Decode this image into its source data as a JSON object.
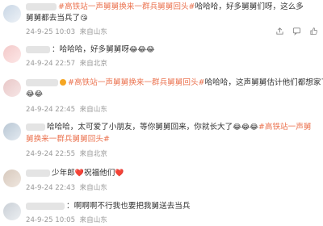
{
  "comments": [
    {
      "line1": "#高铁站一声舅舅换来一群兵舅舅回头#哈哈哈，好多舅舅们呀，这么多",
      "line2": "舅舅都去当兵了",
      "topic": "#高铁站一声舅舅换来一群兵舅舅回头#",
      "text_after_topic": "哈哈哈，好多舅舅们呀，这么多",
      "emoji": "😘",
      "time": "24-9-25 10:03",
      "location": "来自山东"
    },
    {
      "line1": "：哈哈哈，好多舅舅呀",
      "emoji": "😂😂😂",
      "time": "24-9-24 22:57",
      "location": "来自北京"
    },
    {
      "topic": "#高铁站一声舅舅换来一群兵舅舅回头#",
      "text_after_topic": "哈哈哈，这声舅舅估计他们都想家了",
      "emoji": "😂😂",
      "time": "24-9-24 22:45",
      "location": "来自山东"
    },
    {
      "line1_text": "哈哈哈，太可爱了小朋友，等你舅舅回来，你就长大了",
      "line1_emoji": "😂😂😂",
      "topic_part1": "#高铁站一声舅",
      "topic_part2": "舅换来一群兵舅舅回头#",
      "time": "24-9-24 22:55",
      "location": "来自北京"
    },
    {
      "text1": "少年郎",
      "emoji1": "❤️",
      "text2": "祝福他们",
      "emoji2": "❤️",
      "time": "24-9-24 22:43",
      "location": "来自山东"
    },
    {
      "text": "：啊啊啊不行我也要把我舅送去当兵",
      "time": "24-9-25 10:05",
      "location": "来自山东"
    }
  ],
  "actions": {
    "share_icon": "share-icon",
    "comment_icon": "comment-icon",
    "like_icon": "like-icon"
  }
}
